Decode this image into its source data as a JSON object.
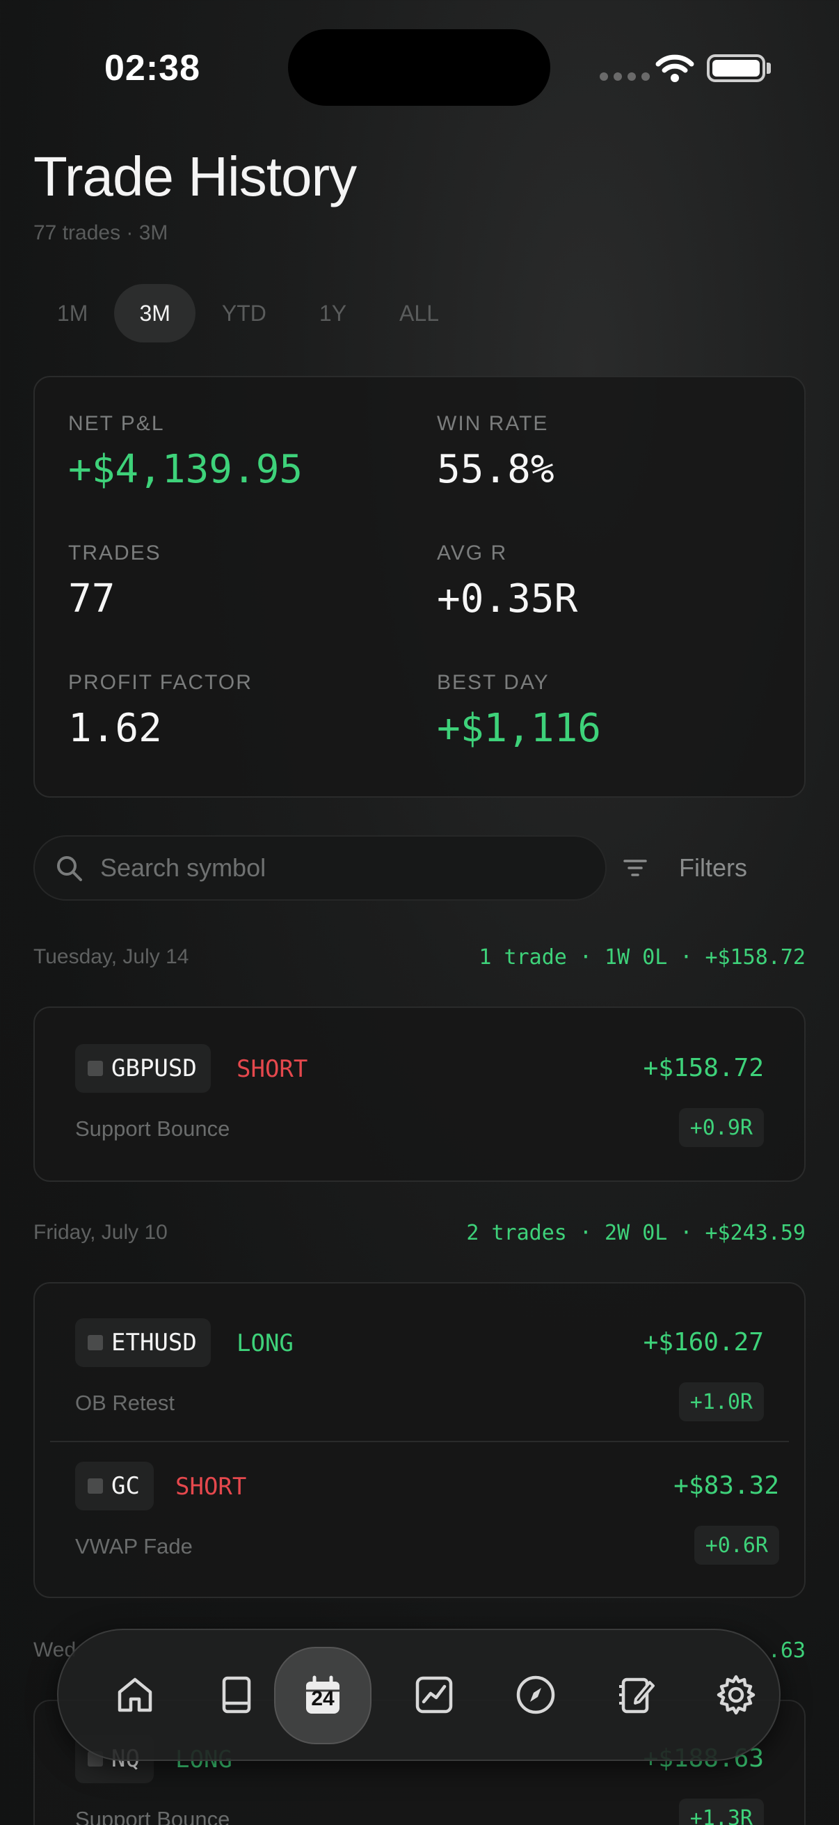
{
  "status": {
    "time": "02:38"
  },
  "header": {
    "title": "Trade History",
    "subtitle": "77 trades · 3M"
  },
  "range_tabs": [
    {
      "label": "1M",
      "active": false
    },
    {
      "label": "3M",
      "active": true
    },
    {
      "label": "YTD",
      "active": false
    },
    {
      "label": "1Y",
      "active": false
    },
    {
      "label": "ALL",
      "active": false
    }
  ],
  "stats": {
    "net_pnl": {
      "label": "NET P&L",
      "value": "+$4,139.95"
    },
    "win_rate": {
      "label": "WIN RATE",
      "value": "55.8%"
    },
    "trades": {
      "label": "TRADES",
      "value": "77"
    },
    "avg_r": {
      "label": "AVG R",
      "value": "+0.35R"
    },
    "profit_factor": {
      "label": "PROFIT FACTOR",
      "value": "1.62"
    },
    "best_day": {
      "label": "BEST DAY",
      "value": "+$1,116"
    }
  },
  "search": {
    "placeholder": "Search symbol"
  },
  "filters": {
    "label": "Filters"
  },
  "days": [
    {
      "date": "Tuesday, July 14",
      "summary": "1 trade · 1W 0L · +$158.72",
      "trades": [
        {
          "symbol": "GBPUSD",
          "side": "SHORT",
          "pnl": "+$158.72",
          "setup": "Support Bounce",
          "r": "+0.9R"
        }
      ]
    },
    {
      "date": "Friday, July 10",
      "summary": "2 trades · 2W 0L · +$243.59",
      "trades": [
        {
          "symbol": "ETHUSD",
          "side": "LONG",
          "pnl": "+$160.27",
          "setup": "OB Retest",
          "r": "+1.0R"
        },
        {
          "symbol": "GC",
          "side": "SHORT",
          "pnl": "+$83.32",
          "setup": "VWAP Fade",
          "r": "+0.6R"
        }
      ]
    },
    {
      "date": "Wed",
      "summary": ".63",
      "trades": [
        {
          "symbol": "NQ",
          "side": "LONG",
          "pnl": "+$188.63",
          "setup": "Support Bounce",
          "r": "+1.3R"
        }
      ]
    }
  ],
  "tab_bar": {
    "items": [
      {
        "icon": "home-icon"
      },
      {
        "icon": "book-icon"
      },
      {
        "icon": "calendar-icon",
        "day": "24",
        "active": true
      },
      {
        "icon": "chart-icon"
      },
      {
        "icon": "compass-icon"
      },
      {
        "icon": "notebook-icon"
      },
      {
        "icon": "gear-icon"
      }
    ]
  },
  "colors": {
    "positive": "#3ed27a",
    "negative": "#e5484d",
    "background": "#141515"
  }
}
